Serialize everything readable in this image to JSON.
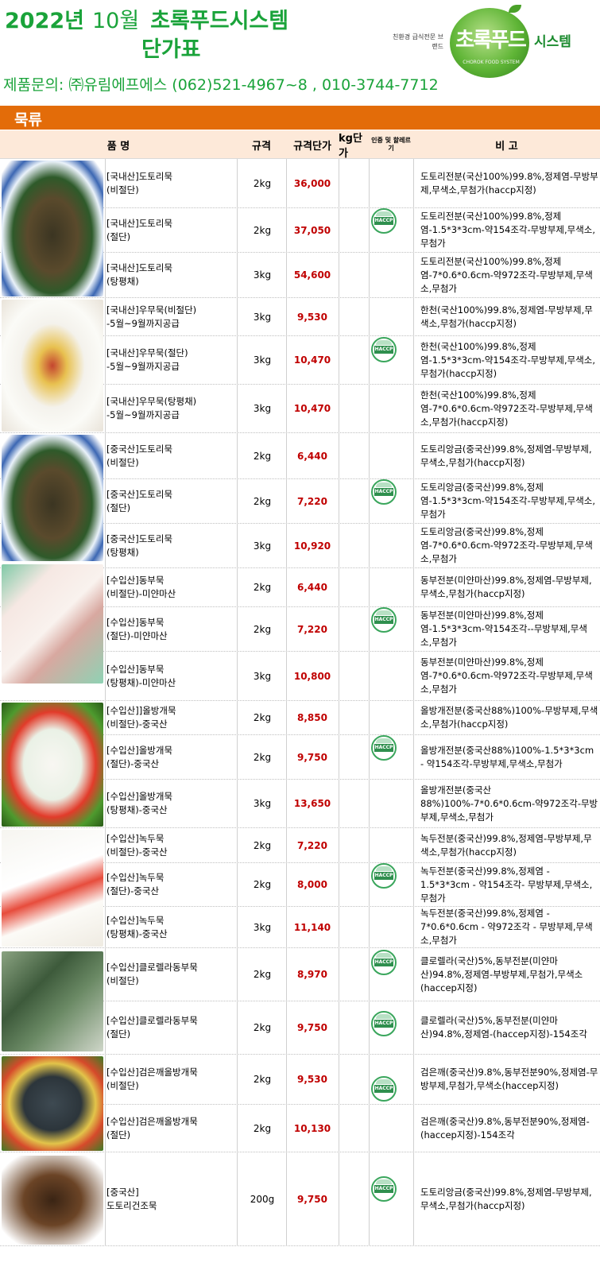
{
  "header": {
    "year": "2022년",
    "month": "10월",
    "company": "초록푸드시스템",
    "doc_title": "단가표",
    "brand_tagline": "친환경 급식전문 브랜드",
    "logo_text": "초록푸드",
    "logo_subtext": "CHOROK FOOD SYSTEM",
    "logo_system": "시스템",
    "contact": "제품문의: ㈜유림에프에스 (062)521-4967~8  , 010-3744-7712"
  },
  "section": {
    "title": "묵류"
  },
  "columns": {
    "name": "품          명",
    "spec": "규격",
    "unit_price": "규격단가",
    "kg_price": "kg단가",
    "cert": "인증 및 할레르기",
    "note": "비          고"
  },
  "colors": {
    "accent": "#e36c09",
    "title_green": "#1aa33a",
    "price_red": "#c00000",
    "header_bg": "#fde9d9"
  },
  "rows": [
    {
      "name": "[국내산]도토리묵\n(비절단)",
      "spec": "2kg",
      "price": "36,000",
      "note": "도토리전분(국산100%)99.8%,정제염-무방부제,무색소,무첨가(haccp지정)"
    },
    {
      "name": "[국내산]도토리묵\n(절단)",
      "spec": "2kg",
      "price": "37,050",
      "note": "도토리전분(국산100%)99.8%,정제염-1.5*3*3cm-약154조각-무방부제,무색소,무첨가"
    },
    {
      "name": "[국내산]도토리묵\n(탕평채)",
      "spec": "3kg",
      "price": "54,600",
      "note": "도토리전분(국산100%)99.8%,정제염-7*0.6*0.6cm-약972조각-무방부제,무색소,무첨가"
    },
    {
      "name": "[국내산]우무묵(비절단)\n-5월~9월까지공급",
      "spec": "3kg",
      "price": "9,530",
      "note": "한천(국산100%)99.8%,정제염-무방부제,무색소,무첨가(haccp지정)"
    },
    {
      "name": "[국내산]우무묵(절단)\n-5월~9월까지공급",
      "spec": "3kg",
      "price": "10,470",
      "note": "한천(국산100%)99.8%,정제염-1.5*3*3cm-약154조각-무방부제,무색소,무첨가(haccp지정)"
    },
    {
      "name": "[국내산]우무묵(탕평채)\n-5월~9월까지공급",
      "spec": "3kg",
      "price": "10,470",
      "note": "한천(국산100%)99.8%,정제염-7*0.6*0.6cm-약972조각-무방부제,무색소,무첨가(haccp지정)"
    },
    {
      "name": "[중국산]도토리묵\n(비절단)",
      "spec": "2kg",
      "price": "6,440",
      "note": "도토리앙금(중국산)99.8%,정제염-무방부제,무색소,무첨가(haccp지정)"
    },
    {
      "name": "[중국산]도토리묵\n(절단)",
      "spec": "2kg",
      "price": "7,220",
      "note": "도토리앙금(중국산)99.8%,정제염-1.5*3*3cm-약154조각-무방부제,무색소,무첨가"
    },
    {
      "name": "[중국산]도토리묵\n(탕평채)",
      "spec": "3kg",
      "price": "10,920",
      "note": "도토리앙금(중국산)99.8%,정제염-7*0.6*0.6cm-약972조각-무방부제,무색소,무첨가"
    },
    {
      "name": "[수입산]동부묵\n(비절단)-미얀마산",
      "spec": "2kg",
      "price": "6,440",
      "note": "동부전분(미얀마산)99.8%,정제염-무방부제,무색소,무첨가(haccp지정)"
    },
    {
      "name": "[수입산]동부묵\n(절단)-미얀마산",
      "spec": "2kg",
      "price": "7,220",
      "note": "동부전분(미얀마산)99.8%,정제염-1.5*3*3cm-약154조각--무방부제,무색소,무첨가"
    },
    {
      "name": "[수입산]동부묵\n(탕평채)-미얀마산",
      "spec": "3kg",
      "price": "10,800",
      "note": "동부전분(미얀마산)99.8%,정제염-7*0.6*0.6cm-약972조각-무방부제,무색소,무첨가"
    },
    {
      "name": "[수입산]]올방개묵\n(비절단)-중국산",
      "spec": "2kg",
      "price": "8,850",
      "note": "올방개전분(중국산88%)100%-무방부제,무색소,무첨가(haccp지정)"
    },
    {
      "name": "[수입산]올방개묵\n(절단)-중국산",
      "spec": "2kg",
      "price": "9,750",
      "note": "올방개전분(중국산88%)100%-1.5*3*3cm - 약154조각-무방부제,무색소,무첨가"
    },
    {
      "name": "[수입산]올방개묵\n(탕평채)-중국산",
      "spec": "3kg",
      "price": "13,650",
      "note": "올방개전분(중국산88%)100%-7*0.6*0.6cm-약972조각-무방부제,무색소,무첨가"
    },
    {
      "name": "[수입산]녹두묵\n(비절단)-중국산",
      "spec": "2kg",
      "price": "7,220",
      "note": "녹두전분(중국산)99.8%,정제염-무방부제,무색소,무첨가(haccp지정)"
    },
    {
      "name": "[수입산]녹두묵\n(절단)-중국산",
      "spec": "2kg",
      "price": "8,000",
      "note": "녹두전분(중국산)99.8%,정제염 - 1.5*3*3cm - 약154조각- 무방부제,무색소,무첨가"
    },
    {
      "name": "[수입산]녹두묵\n(탕평채)-중국산",
      "spec": "3kg",
      "price": "11,140",
      "note": "녹두전분(중국산)99.8%,정제염 - 7*0.6*0.6cm - 약972조각 - 무방부제,무색소,무첨가"
    },
    {
      "name": "[수입산]클로렐라동부묵\n(비절단)",
      "spec": "2kg",
      "price": "8,970",
      "note": "클로렐라(국산)5%,동부전분(미얀마산)94.8%,정제염-부방부제,무첨가,무색소(haccep지정)"
    },
    {
      "name": "[수입산]클로렐라동부묵\n(절단)",
      "spec": "2kg",
      "price": "9,750",
      "note": "클로렐라(국산)5%,동부전분(미얀마산)94.8%,정제염-(haccep지정)-154조각"
    },
    {
      "name": "[수입산]검은깨올방개묵\n(비절단)",
      "spec": "2kg",
      "price": "9,530",
      "note": "검은깨(중국산)9.8%,동부전분90%,정제염-무방부제,무첨가,무색소(haccep지정)"
    },
    {
      "name": "[수입산]검은깨올방개묵\n(절단)",
      "spec": "2kg",
      "price": "10,130",
      "note": "검은깨(중국산)9.8%,동부전분90%,정제염-(haccep지정)-154조각"
    },
    {
      "name": "[중국산]\n도토리건조묵",
      "spec": "200g",
      "price": "9,750",
      "note": "도토리앙금(중국산)99.8%,정제염-무방부제,무색소,무첨가(haccp지정)"
    }
  ],
  "product_images": [
    "dotori-domestic-photo",
    "umu-photo",
    "dotori-china-photo",
    "dongbu-photo",
    "olbang-photo",
    "nokdu-photo",
    "chlorella-photo",
    "black-sesame-photo",
    "dried-dotori-photo"
  ],
  "haccp_label": "HACCP"
}
